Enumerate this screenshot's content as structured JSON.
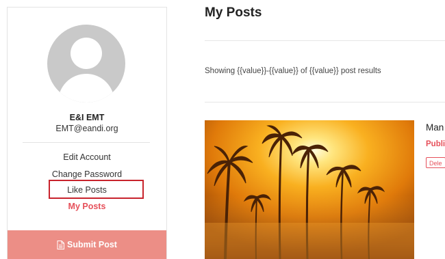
{
  "sidebar": {
    "user_name": "E&I EMT",
    "user_email": "EMT@eandi.org",
    "menu": {
      "edit_account": "Edit Account",
      "change_password": "Change Password",
      "like_posts": "Like Posts",
      "my_posts": "My Posts"
    },
    "submit_label": "Submit Post"
  },
  "main": {
    "title": "My Posts",
    "results_text": "Showing {{value}}-{{value}} of {{value}} post results",
    "post": {
      "title": "Man",
      "status": "Publi",
      "delete_label": "Dele"
    }
  },
  "colors": {
    "accent": "#e6505a",
    "submit_bg": "#ec8e86",
    "highlight": "#c8232c"
  }
}
